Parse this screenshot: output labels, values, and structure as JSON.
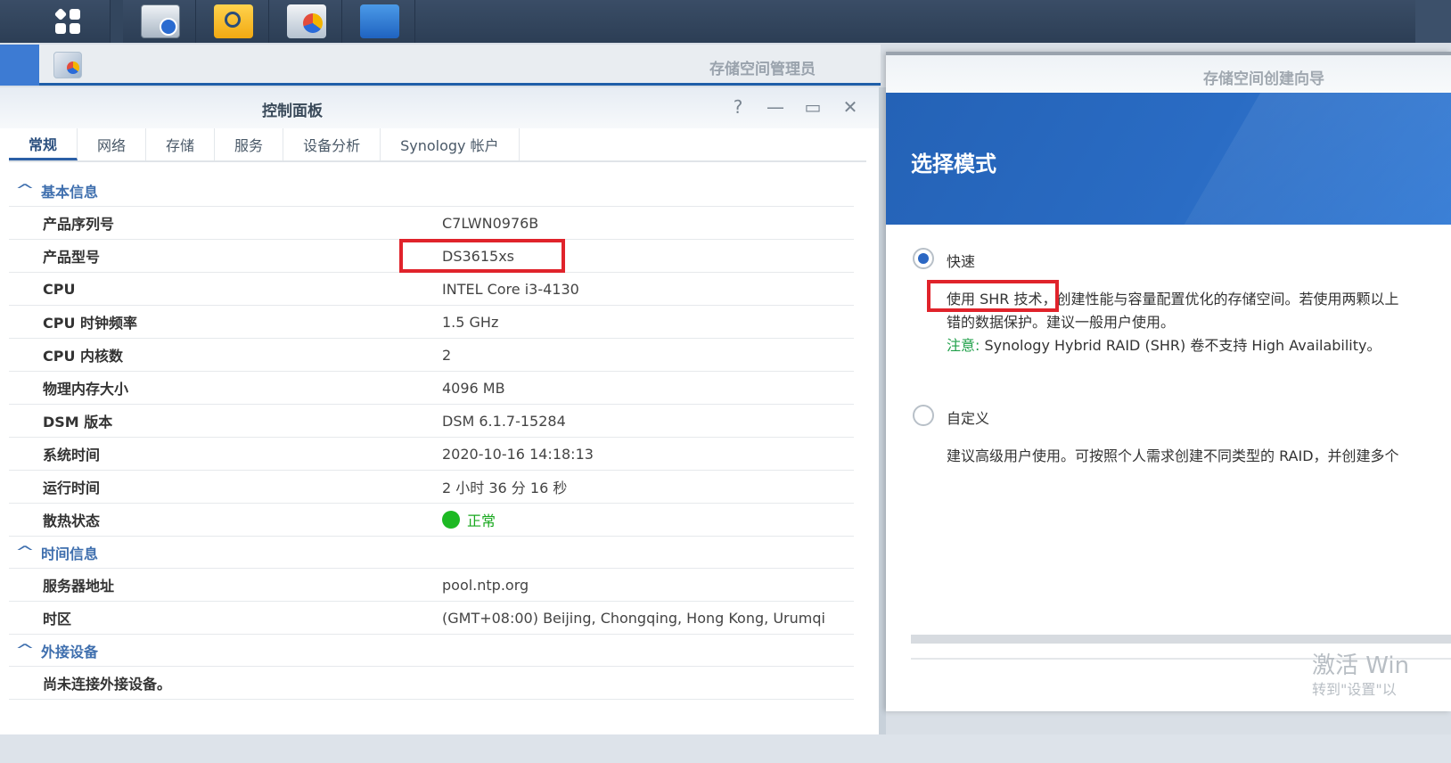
{
  "storage_manager": {
    "title": "存储空间管理员"
  },
  "control_panel": {
    "title": "控制面板",
    "controls": {
      "help": "?",
      "minimize": "—",
      "maximize": "▭",
      "close": "✕"
    },
    "tabs": [
      "常规",
      "网络",
      "存储",
      "服务",
      "设备分析",
      "Synology 帐户"
    ],
    "sections": {
      "basic": {
        "label": "基本信息",
        "rows": [
          {
            "k": "产品序列号",
            "v": "C7LWN0976B"
          },
          {
            "k": "产品型号",
            "v": "DS3615xs"
          },
          {
            "k": "CPU",
            "v": "INTEL Core i3-4130"
          },
          {
            "k": "CPU 时钟频率",
            "v": "1.5 GHz"
          },
          {
            "k": "CPU 内核数",
            "v": "2"
          },
          {
            "k": "物理内存大小",
            "v": "4096 MB"
          },
          {
            "k": "DSM 版本",
            "v": "DSM 6.1.7-15284"
          },
          {
            "k": "系统时间",
            "v": "2020-10-16 14:18:13"
          },
          {
            "k": "运行时间",
            "v": "2 小时 36 分 16 秒"
          },
          {
            "k": "散热状态",
            "v": "正常"
          }
        ]
      },
      "time": {
        "label": "时间信息",
        "rows": [
          {
            "k": "服务器地址",
            "v": "pool.ntp.org"
          },
          {
            "k": "时区",
            "v": "(GMT+08:00) Beijing, Chongqing, Hong Kong, Urumqi"
          }
        ]
      },
      "external": {
        "label": "外接设备",
        "empty": "尚未连接外接设备。"
      }
    }
  },
  "wizard": {
    "title": "存储空间创建向导",
    "heading": "选择模式",
    "option_quick": {
      "label": "快速",
      "line1": "使用 SHR 技术，创建性能与容量配置优化的存储空间。若使用两颗以上",
      "line2": "错的数据保护。建议一般用户使用。",
      "note_key": "注意:",
      "note": "Synology Hybrid RAID (SHR) 卷不支持 High Availability。"
    },
    "option_custom": {
      "label": "自定义",
      "line1": "建议高级用户使用。可按照个人需求创建不同类型的 RAID，并创建多个"
    },
    "watermark": {
      "line1": "激活 Win",
      "line2": "转到\"设置\"以"
    }
  },
  "colors": {
    "accent": "#2b5fa6",
    "highlight": "#e0232b",
    "ok": "#1db923"
  }
}
